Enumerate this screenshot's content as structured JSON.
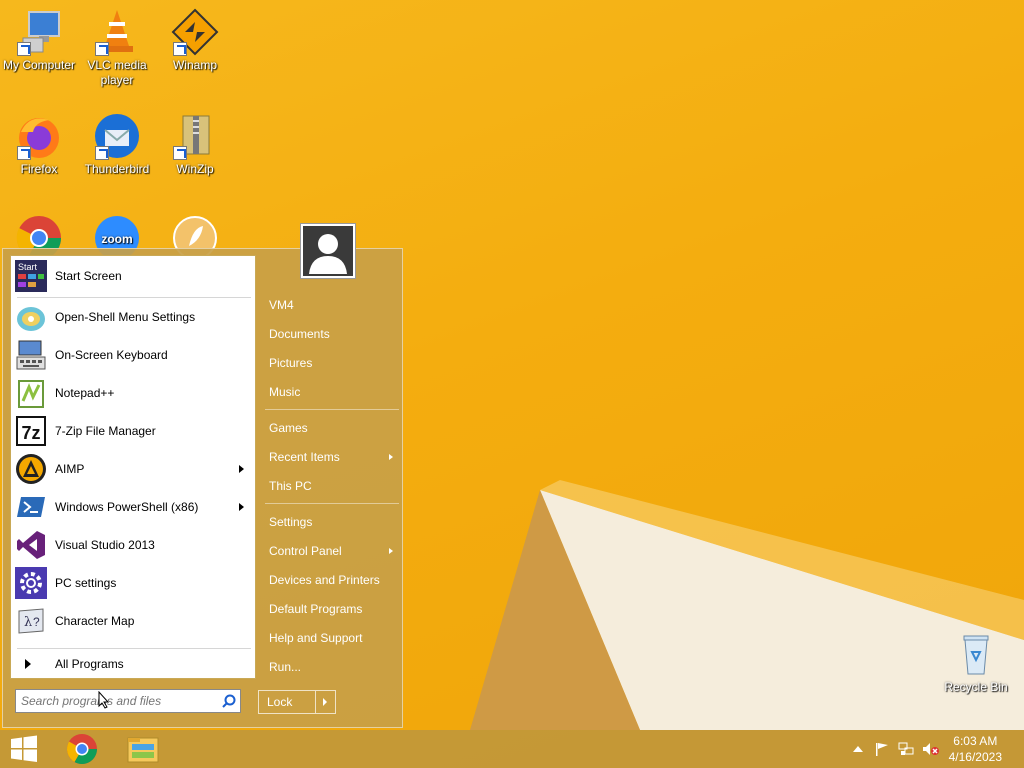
{
  "desktop": {
    "icons": [
      {
        "label": "My Computer",
        "icon": "computer-icon"
      },
      {
        "label": "VLC media player",
        "icon": "vlc-icon"
      },
      {
        "label": "Winamp",
        "icon": "winamp-icon"
      },
      {
        "label": "Firefox",
        "icon": "firefox-icon"
      },
      {
        "label": "Thunderbird",
        "icon": "thunderbird-icon"
      },
      {
        "label": "WinZip",
        "icon": "winzip-icon"
      },
      {
        "label": "",
        "icon": "chrome-icon"
      },
      {
        "label": "",
        "icon": "zoom-icon"
      },
      {
        "label": "",
        "icon": "app-icon"
      },
      {
        "label": "Recycle Bin",
        "icon": "recycle-bin-icon"
      }
    ],
    "zoom_text": "zoom"
  },
  "start_menu": {
    "start_tile_text": "Start",
    "programs": [
      {
        "label": "Start Screen",
        "icon": "start-screen-icon",
        "submenu": false
      },
      {
        "label": "Open-Shell Menu Settings",
        "icon": "open-shell-icon",
        "submenu": false
      },
      {
        "label": "On-Screen Keyboard",
        "icon": "keyboard-icon",
        "submenu": false
      },
      {
        "label": "Notepad++",
        "icon": "notepadpp-icon",
        "submenu": false
      },
      {
        "label": "7-Zip File Manager",
        "icon": "7zip-icon",
        "submenu": false
      },
      {
        "label": "AIMP",
        "icon": "aimp-icon",
        "submenu": true
      },
      {
        "label": "Windows PowerShell (x86)",
        "icon": "powershell-icon",
        "submenu": true
      },
      {
        "label": "Visual Studio 2013",
        "icon": "visual-studio-icon",
        "submenu": false
      },
      {
        "label": "PC settings",
        "icon": "gear-icon",
        "submenu": false
      },
      {
        "label": "Character Map",
        "icon": "character-map-icon",
        "submenu": false
      }
    ],
    "all_programs": "All Programs",
    "search_placeholder": "Search programs and files",
    "right_items": [
      {
        "label": "VM4",
        "submenu": false
      },
      {
        "label": "Documents",
        "submenu": false
      },
      {
        "label": "Pictures",
        "submenu": false
      },
      {
        "label": "Music",
        "submenu": false
      },
      {
        "label": "Games",
        "submenu": false
      },
      {
        "label": "Recent Items",
        "submenu": true
      },
      {
        "label": "This PC",
        "submenu": false
      },
      {
        "label": "Settings",
        "submenu": false
      },
      {
        "label": "Control Panel",
        "submenu": true
      },
      {
        "label": "Devices and Printers",
        "submenu": false
      },
      {
        "label": "Default Programs",
        "submenu": false
      },
      {
        "label": "Help and Support",
        "submenu": false
      },
      {
        "label": "Run...",
        "submenu": false
      }
    ],
    "lock_label": "Lock"
  },
  "taskbar": {
    "pinned": [
      "windows-start-icon",
      "chrome-icon",
      "file-explorer-icon"
    ],
    "tray": [
      "chevron-up-icon",
      "flag-icon",
      "network-icon",
      "speaker-muted-icon"
    ],
    "time": "6:03 AM",
    "date": "4/16/2023"
  },
  "colors": {
    "wallpaper": "#f4ad0f",
    "menu_bg": "#c8a046",
    "taskbar_bg": "#be963c"
  }
}
